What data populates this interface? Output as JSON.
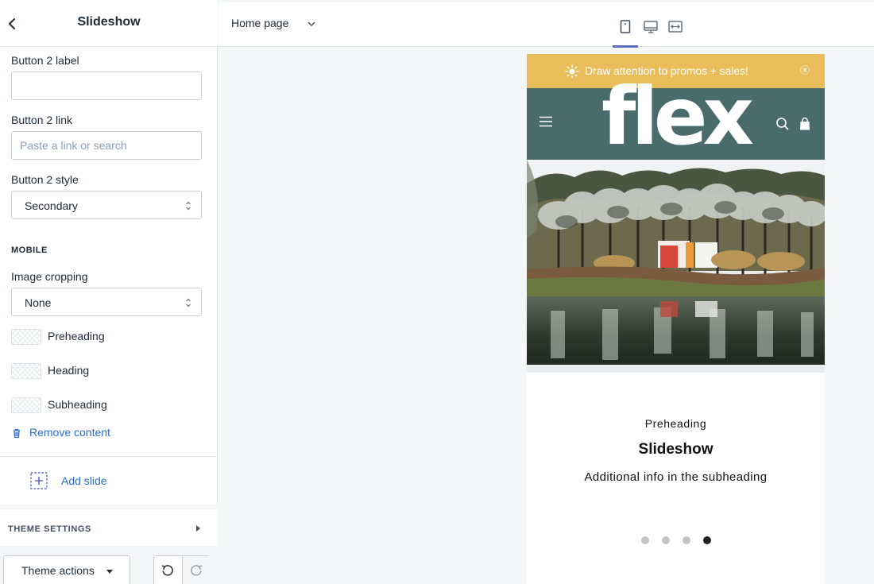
{
  "sidebar": {
    "title": "Slideshow",
    "button2_label": {
      "label": "Button 2 label",
      "value": ""
    },
    "button2_link": {
      "label": "Button 2 link",
      "placeholder": "Paste a link or search"
    },
    "button2_style": {
      "label": "Button 2 style",
      "value": "Secondary"
    },
    "mobile_section": "MOBILE",
    "image_cropping": {
      "label": "Image cropping",
      "value": "None"
    },
    "image_items": [
      "Preheading",
      "Heading",
      "Subheading"
    ],
    "remove_content": "Remove content",
    "add_slide": "Add slide",
    "theme_settings": "THEME SETTINGS",
    "theme_actions": "Theme actions"
  },
  "topbar": {
    "page": "Home page",
    "devices": [
      "mobile-icon",
      "desktop-icon",
      "full-width-icon"
    ],
    "active_device": "mobile"
  },
  "preview": {
    "promo": "Draw attention to promos + sales!",
    "logo": "flex",
    "preheading": "Preheading",
    "heading": "Slideshow",
    "subheading": "Additional info in the subheading",
    "slide_count": 4,
    "active_slide": 4
  },
  "colors": {
    "promo_bar": "#e8bd5a",
    "header": "#4a6b6c",
    "link": "#2c6ecb",
    "active_tab": "#5c6ac4"
  }
}
